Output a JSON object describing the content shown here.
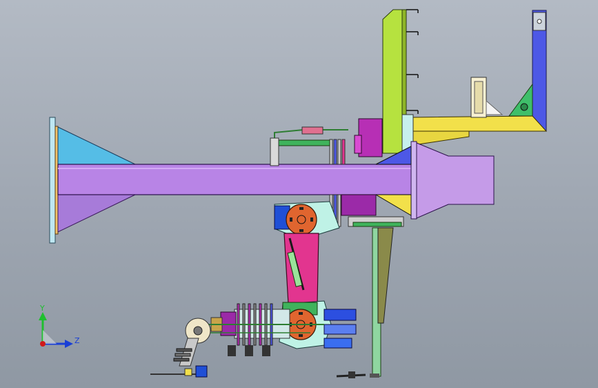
{
  "viewport": {
    "background_top": "#b3bac4",
    "background_bottom": "#8f98a3"
  },
  "triad": {
    "y_label": "Y",
    "z_label": "Z",
    "y_color": "#1fbf2f",
    "z_color": "#1a3fd6",
    "x_color": "#d01a1a"
  },
  "colors": {
    "beam": "#b884e6",
    "cone": "#55bde6",
    "cone_lower": "#a77bd9",
    "mast": "#b6e23f",
    "frame_blue": "#4d58e6",
    "frame_yellow": "#f2e04a",
    "pink_arm": "#e2358f",
    "orange_joint": "#e0652f",
    "teal": "#8fd6c9",
    "magenta": "#b72fb5"
  }
}
